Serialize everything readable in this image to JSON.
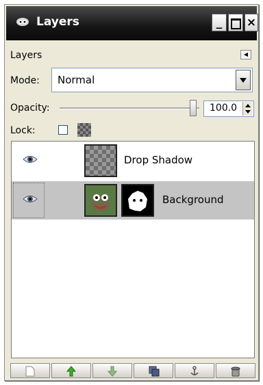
{
  "window": {
    "title": "Layers",
    "minimize_label": "_",
    "close_label": "×"
  },
  "panel": {
    "label": "Layers",
    "menu_icon": "panel-menu-icon"
  },
  "mode": {
    "label": "Mode:",
    "value": "Normal"
  },
  "opacity": {
    "label": "Opacity:",
    "value": "100.0",
    "slider_fraction": 1.0
  },
  "lock": {
    "label": "Lock:",
    "pixels_locked": false,
    "alpha_icon": "alpha-lock-icon"
  },
  "layers": [
    {
      "name": "Drop Shadow",
      "visible": true,
      "selected": false,
      "has_mask": false
    },
    {
      "name": "Background",
      "visible": true,
      "selected": true,
      "has_mask": true
    }
  ],
  "bottom_buttons": [
    {
      "name": "new-layer-button",
      "icon": "new-document-icon"
    },
    {
      "name": "raise-layer-button",
      "icon": "arrow-up-icon"
    },
    {
      "name": "lower-layer-button",
      "icon": "arrow-down-icon"
    },
    {
      "name": "duplicate-layer-button",
      "icon": "duplicate-icon"
    },
    {
      "name": "anchor-layer-button",
      "icon": "anchor-icon"
    },
    {
      "name": "delete-layer-button",
      "icon": "trash-icon"
    }
  ],
  "colors": {
    "titlebar": "#111111",
    "panel_bg": "#ece9d8",
    "selected_row": "#c4c4c4",
    "arrow_up": "#3fae2a",
    "arrow_down": "#8fbf7a"
  }
}
